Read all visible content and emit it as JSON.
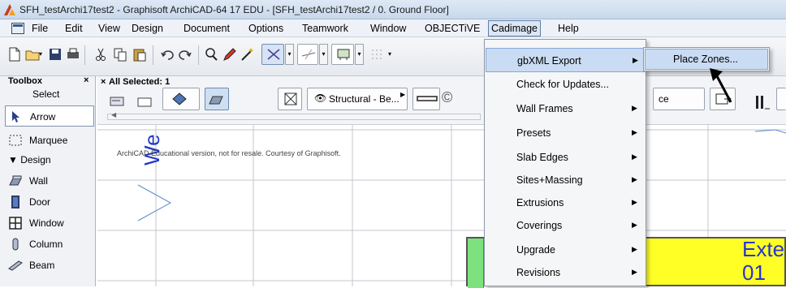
{
  "window": {
    "title": "SFH_testArchi17test2 - Graphisoft ArchiCAD-64 17 EDU - [SFH_testArchi17test2 / 0. Ground Floor]",
    "logo_icon": "archicad-logo-icon"
  },
  "menubar": {
    "items": [
      "File",
      "Edit",
      "View",
      "Design",
      "Document",
      "Options",
      "Teamwork",
      "Window",
      "OBJECTiVE",
      "Cadimage",
      "Help"
    ],
    "active": "Cadimage"
  },
  "toolbox": {
    "title": "Toolbox",
    "close": "×",
    "select_label": "Select",
    "tools_top": [
      "Arrow",
      "Marquee"
    ],
    "section": "Design",
    "tools_design": [
      "Wall",
      "Door",
      "Window",
      "Column",
      "Beam"
    ]
  },
  "infobox": {
    "close": "×",
    "selection": "All Selected: 1",
    "structural_label": "Structural - Be...",
    "ce_label": "ce"
  },
  "drawing": {
    "notice": "ArchiCAD Educational version, not for resale. Courtesy of Graphisoft.",
    "vertical_text": "We",
    "zone_name": "Exter",
    "zone_number": "01"
  },
  "cadimage_menu": {
    "items": [
      "gbXML Export",
      "Check for Updates...",
      "Wall Frames",
      "Presets",
      "Slab Edges",
      "Sites+Massing",
      "Extrusions",
      "Coverings",
      "Upgrade",
      "Revisions"
    ],
    "has_submenu": [
      true,
      false,
      true,
      true,
      true,
      true,
      true,
      true,
      true,
      true
    ],
    "highlighted": "gbXML Export",
    "arrow": "▶"
  },
  "gbxml_submenu": {
    "items": [
      "Place Zones..."
    ]
  },
  "colors": {
    "zone_fill": "#ffff26",
    "zone_text": "#2836c8",
    "menu_highlight": "#c9dcf3"
  }
}
